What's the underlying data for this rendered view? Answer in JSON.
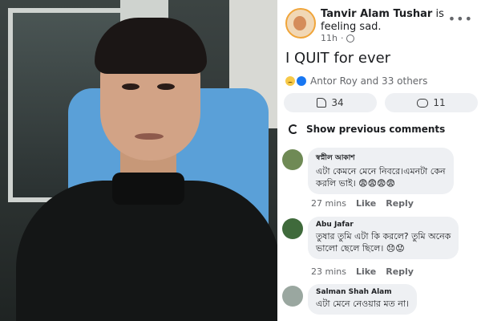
{
  "post": {
    "author": "Tanvir Alam Tushar",
    "feeling": "is feeling sad.",
    "time": "11h",
    "text": "I QUIT for ever",
    "reactions_text": "Antor Roy and 33 others",
    "like_count": "34",
    "comment_count": "11"
  },
  "comments_header": "Show previous comments",
  "comments": [
    {
      "name": "স্বপ্নীল আকাশ",
      "text": "এটা কেমনে মেনে নিবরে।এমনটা কেন\nকরলি ভাই। 😨😨😨😨",
      "time": "27 mins",
      "like": "Like",
      "reply": "Reply"
    },
    {
      "name": "Abu Jafar",
      "text": "তুষার তুমি এটা কি করলে?  তুমি অনেক\nভালো ছেলে ছিলে। 😞😟",
      "time": "23 mins",
      "like": "Like",
      "reply": "Reply"
    },
    {
      "name": "Salman Shah Alam",
      "text": "এটা মেনে নেওয়ার মত না।"
    }
  ],
  "colors": {
    "accent": "#1877f2",
    "bubble": "#eef0f3"
  },
  "icons": [
    "globe-icon",
    "more-icon",
    "sad-reaction-icon",
    "like-reaction-icon",
    "thumb-icon",
    "comment-icon",
    "refresh-icon"
  ]
}
